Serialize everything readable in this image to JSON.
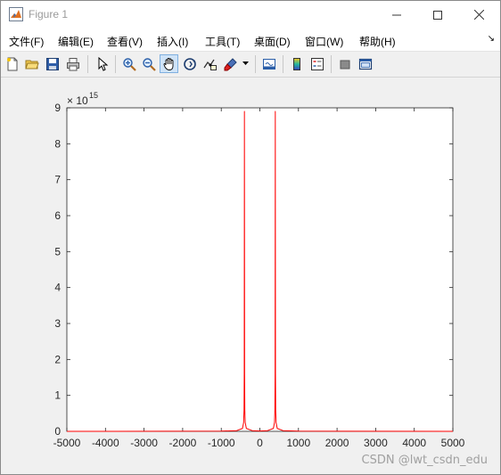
{
  "window": {
    "title": "Figure 1"
  },
  "title_icons": {
    "app": "matlab-figure-icon",
    "minimize": "minimize-icon",
    "maximize": "maximize-icon",
    "close": "close-icon"
  },
  "menu": {
    "items": [
      "文件(F)",
      "编辑(E)",
      "查看(V)",
      "插入(I)",
      "工具(T)",
      "桌面(D)",
      "窗口(W)",
      "帮助(H)"
    ],
    "overflow_icon": "chevron-icon"
  },
  "toolbar": {
    "buttons": [
      "new-figure-icon",
      "open-file-icon",
      "save-icon",
      "print-icon",
      "edit-plot-icon",
      "zoom-in-icon",
      "zoom-out-icon",
      "pan-icon",
      "rotate-3d-icon",
      "data-cursor-icon",
      "brush-icon",
      "link-plot-icon",
      "colorbar-icon",
      "legend-icon",
      "hide-plot-tools-icon",
      "show-plot-tools-icon"
    ],
    "active": "pan-icon"
  },
  "chart_data": {
    "type": "line",
    "title": "",
    "xlabel": "",
    "ylabel": "",
    "xlim": [
      -5000,
      5000
    ],
    "ylim": [
      0,
      9
    ],
    "y_exponent_label": "× 10",
    "y_exponent": "15",
    "xticks": [
      -5000,
      -4000,
      -3000,
      -2000,
      -1000,
      0,
      1000,
      2000,
      3000,
      4000,
      5000
    ],
    "yticks": [
      0,
      1,
      2,
      3,
      4,
      5,
      6,
      7,
      8,
      9
    ],
    "grid": false,
    "line_color": "#ff0000",
    "series": [
      {
        "x": [
          -5000,
          -1000,
          -600,
          -450,
          -420,
          -410,
          -405,
          -400,
          -395,
          -390,
          -380,
          -350,
          -200,
          0,
          200,
          350,
          380,
          390,
          395,
          400,
          405,
          410,
          420,
          450,
          600,
          1000,
          5000
        ],
        "values": [
          0,
          0.005,
          0.02,
          0.08,
          0.25,
          0.6,
          1.6,
          8.9,
          1.6,
          0.6,
          0.25,
          0.08,
          0.02,
          0.01,
          0.02,
          0.08,
          0.25,
          0.6,
          1.6,
          8.9,
          1.6,
          0.6,
          0.25,
          0.08,
          0.02,
          0.005,
          0
        ]
      }
    ]
  },
  "watermark": "CSDN @lwt_csdn_edu"
}
